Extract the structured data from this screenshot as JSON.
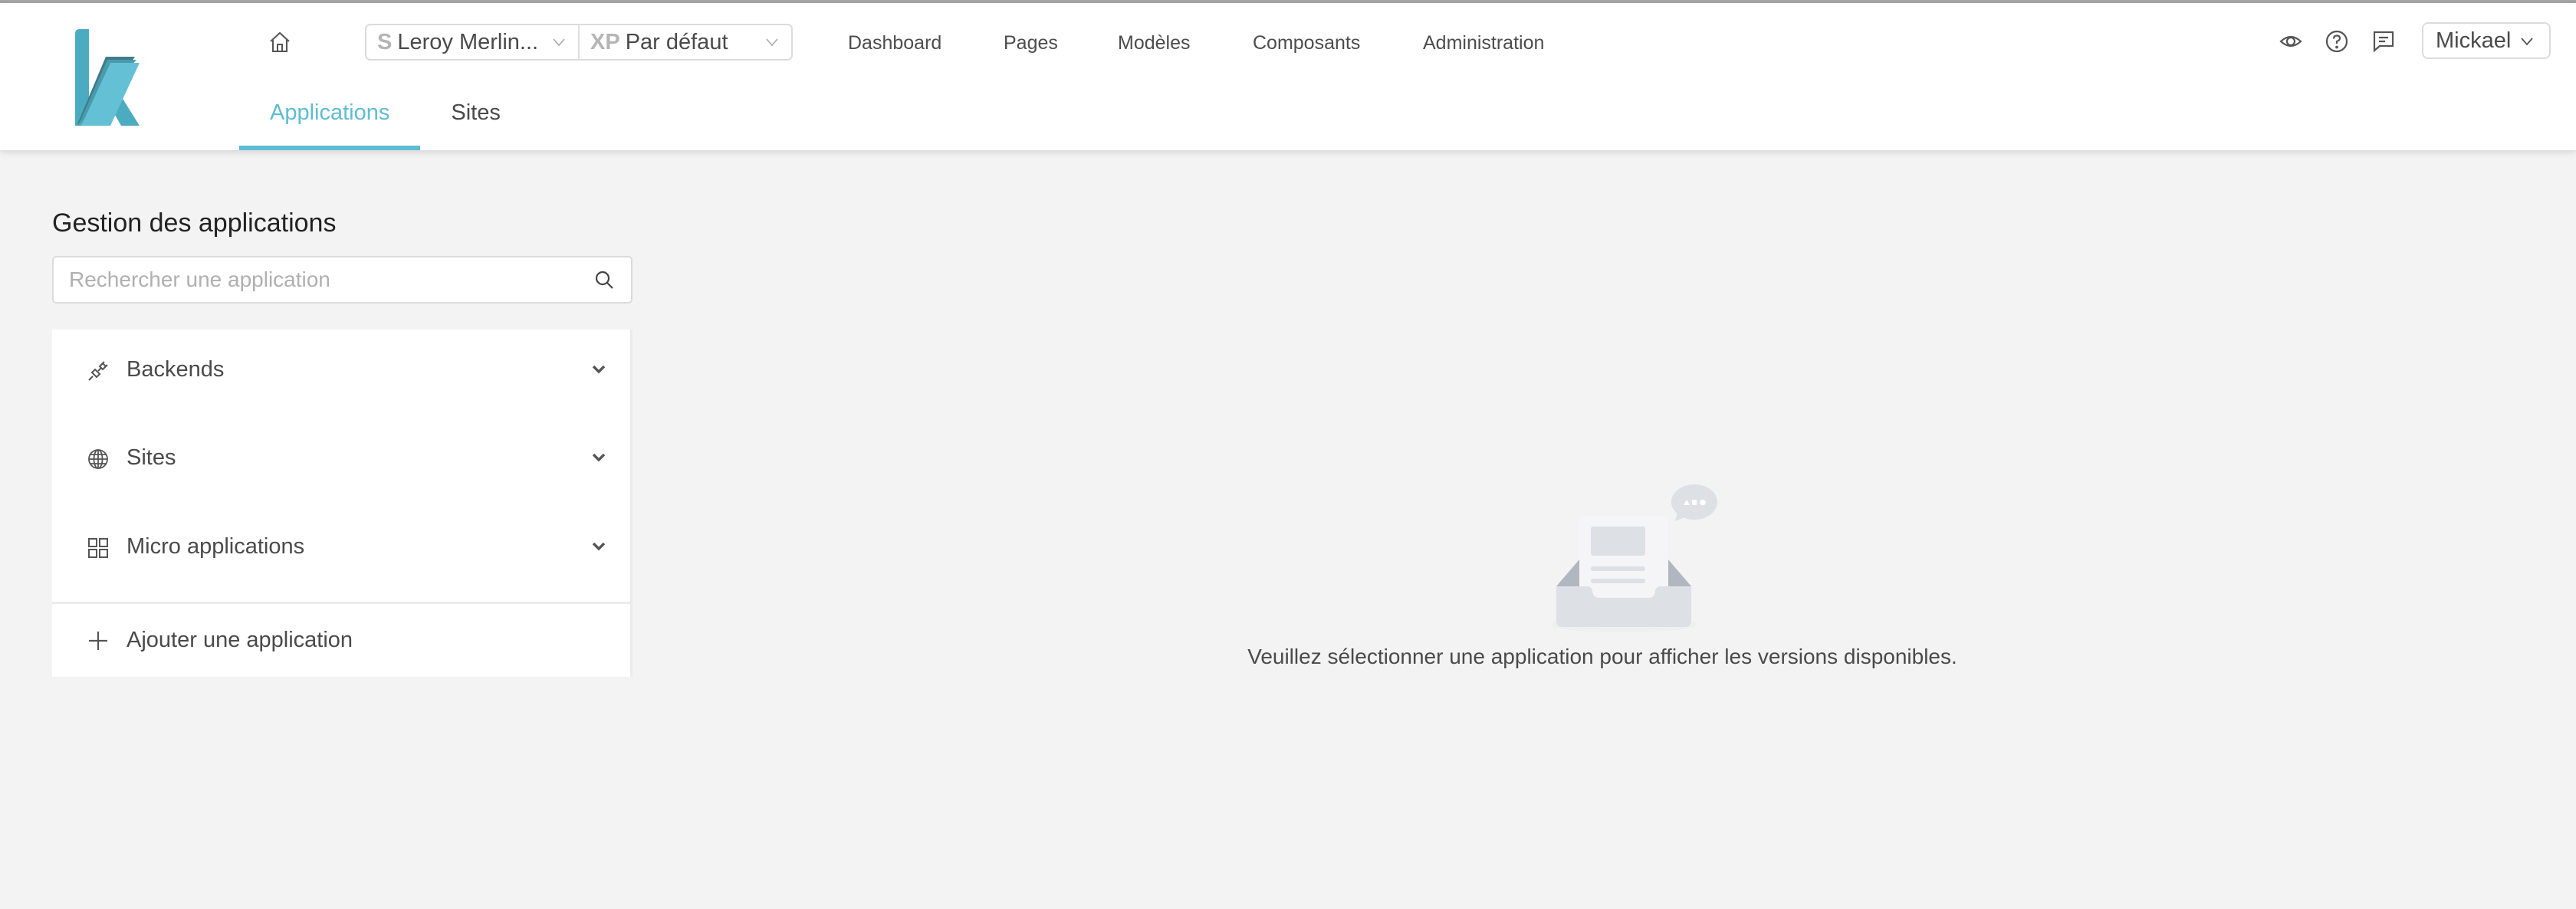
{
  "header": {
    "logo_alt": "k",
    "home_icon": "home-icon",
    "site_select": {
      "prefix": "S",
      "value": "Leroy Merlin..."
    },
    "xp_select": {
      "prefix": "XP",
      "value": "Par défaut"
    },
    "nav": [
      {
        "label": "Dashboard"
      },
      {
        "label": "Pages"
      },
      {
        "label": "Modèles"
      },
      {
        "label": "Composants"
      },
      {
        "label": "Administration"
      }
    ],
    "icons": [
      "eye-icon",
      "help-icon",
      "feedback-icon"
    ],
    "user": {
      "name": "Mickael"
    },
    "tabs": [
      {
        "label": "Applications",
        "active": true
      },
      {
        "label": "Sites",
        "active": false
      }
    ]
  },
  "sidebar": {
    "title": "Gestion des applications",
    "search": {
      "placeholder": "Rechercher une application",
      "value": ""
    },
    "groups": [
      {
        "label": "Backends",
        "icon": "plug-icon",
        "expanded": false
      },
      {
        "label": "Sites",
        "icon": "globe-icon",
        "expanded": false
      },
      {
        "label": "Micro applications",
        "icon": "grid-icon",
        "expanded": false
      }
    ],
    "add_label": "Ajouter une application"
  },
  "main": {
    "empty_message": "Veuillez sélectionner une application pour afficher les versions disponibles."
  },
  "colors": {
    "accent": "#5fbcd3",
    "background": "#f3f3f3",
    "text": "#4a4a4a"
  }
}
